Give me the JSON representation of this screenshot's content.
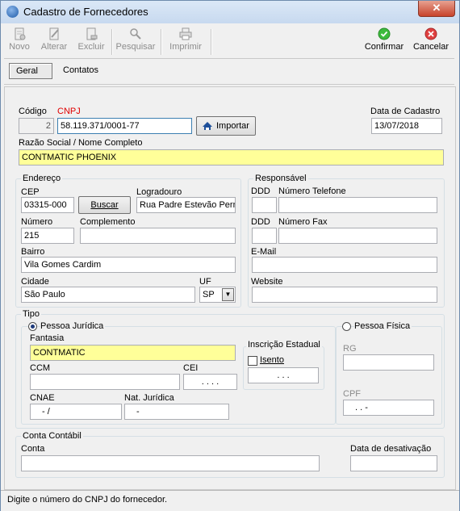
{
  "window": {
    "title": "Cadastro de Fornecedores",
    "close_label": "✕"
  },
  "toolbar": {
    "novo": "Novo",
    "alterar": "Alterar",
    "excluir": "Excluir",
    "pesquisar": "Pesquisar",
    "imprimir": "Imprimir",
    "confirmar": "Confirmar",
    "cancelar": "Cancelar"
  },
  "tabs": {
    "geral": "Geral",
    "contatos": "Contatos"
  },
  "header": {
    "codigo_label": "Código",
    "codigo_value": "2",
    "cnpj_label": "CNPJ",
    "cnpj_value": "58.119.371/0001-77",
    "importar_label": "Importar",
    "data_cadastro_label": "Data de Cadastro",
    "data_cadastro_value": "13/07/2018",
    "razao_label": "Razão Social / Nome Completo",
    "razao_value": "CONTMATIC PHOENIX"
  },
  "endereco": {
    "title": "Endereço",
    "cep_label": "CEP",
    "cep_value": "03315-000",
    "buscar_label": "Buscar",
    "logradouro_label": "Logradouro",
    "logradouro_value": "Rua Padre Estevão Pern",
    "numero_label": "Número",
    "numero_value": "215",
    "complemento_label": "Complemento",
    "complemento_value": "",
    "bairro_label": "Bairro",
    "bairro_value": "Vila Gomes Cardim",
    "cidade_label": "Cidade",
    "cidade_value": "São Paulo",
    "uf_label": "UF",
    "uf_value": "SP"
  },
  "responsavel": {
    "title": "Responsável",
    "ddd_label": "DDD",
    "telefone_label": "Número Telefone",
    "ddd_fax_label": "DDD",
    "fax_label": "Número Fax",
    "email_label": "E-Mail",
    "website_label": "Website"
  },
  "tipo": {
    "title": "Tipo",
    "pj_label": "Pessoa Jurídica",
    "fantasia_label": "Fantasia",
    "fantasia_value": "CONTMATIC",
    "ccm_label": "CCM",
    "cei_label": "CEI",
    "cei_value": ".  .  .  .",
    "ie_title": "Inscrição Estadual",
    "isento_label": "Isento",
    "ie_value": ".  .  .",
    "cnae_label": "CNAE",
    "cnae_value": "-  /",
    "nat_label": "Nat. Jurídica",
    "nat_value": "-",
    "pf_label": "Pessoa Física",
    "rg_label": "RG",
    "cpf_label": "CPF",
    "cpf_value": ".  .  -"
  },
  "conta": {
    "title": "Conta Contábil",
    "conta_label": "Conta",
    "desativacao_label": "Data de desativação"
  },
  "status": {
    "text": "Digite o número do CNPJ do fornecedor."
  }
}
